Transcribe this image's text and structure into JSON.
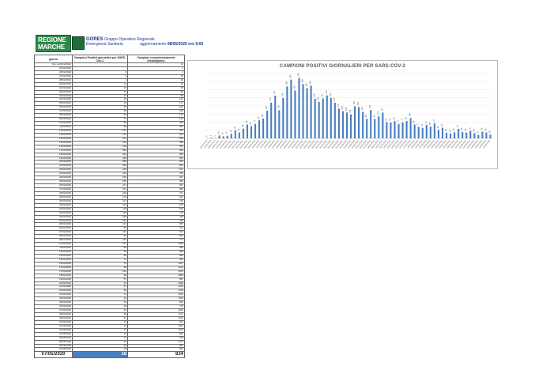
{
  "header": {
    "logo_line1": "REGIONE",
    "logo_line2": "MARCHE",
    "group_name": "GORES",
    "group_line1": "Gruppo Operativo Regionale",
    "group_line2": "Emergenza Sanitaria",
    "update_label": "aggiornamento",
    "update_value": "08/05/2020 ore 9:00"
  },
  "table": {
    "col_date": "giorno",
    "col_positive": "Campioni Positivi giornalieri per SARS-Cov-2",
    "col_total": "Campioni complessivamente testati/giorno",
    "rows": [
      [
        "fino al 24/02/2020",
        "",
        "13"
      ],
      [
        "25/02/2020",
        "",
        "2"
      ],
      [
        "26/02/2020",
        "0",
        "4"
      ],
      [
        "27/02/2020",
        "3",
        "18"
      ],
      [
        "28/02/2020",
        "1",
        "29"
      ],
      [
        "29/02/2020",
        "14",
        "33"
      ],
      [
        "01/03/2020",
        "10",
        "48"
      ],
      [
        "02/03/2020",
        "13",
        "83"
      ],
      [
        "03/03/2020",
        "23",
        "89"
      ],
      [
        "04/03/2020",
        "40",
        "131"
      ],
      [
        "05/03/2020",
        "29",
        "171"
      ],
      [
        "06/03/2020",
        "48",
        "220"
      ],
      [
        "07/03/2020",
        "68",
        "198"
      ],
      [
        "08/03/2020",
        "60",
        "179"
      ],
      [
        "09/03/2020",
        "71",
        "187"
      ],
      [
        "10/03/2020",
        "89",
        "218"
      ],
      [
        "11/03/2020",
        "98",
        "267"
      ],
      [
        "12/03/2020",
        "137",
        "411"
      ],
      [
        "13/03/2020",
        "176",
        "519"
      ],
      [
        "14/03/2020",
        "211",
        "599"
      ],
      [
        "15/03/2020",
        "139",
        "388"
      ],
      [
        "16/03/2020",
        "199",
        "565"
      ],
      [
        "17/03/2020",
        "256",
        "693"
      ],
      [
        "18/03/2020",
        "290",
        "682"
      ],
      [
        "19/03/2020",
        "236",
        "654"
      ],
      [
        "20/03/2020",
        "298",
        "813"
      ],
      [
        "21/03/2020",
        "268",
        "802"
      ],
      [
        "22/03/2020",
        "248",
        "674"
      ],
      [
        "23/03/2020",
        "260",
        "783"
      ],
      [
        "24/03/2020",
        "196",
        "617"
      ],
      [
        "25/03/2020",
        "180",
        "596"
      ],
      [
        "26/03/2020",
        "197",
        "637"
      ],
      [
        "27/03/2020",
        "212",
        "808"
      ],
      [
        "28/03/2020",
        "200",
        "741"
      ],
      [
        "29/03/2020",
        "176",
        "642"
      ],
      [
        "30/03/2020",
        "147",
        "736"
      ],
      [
        "31/03/2020",
        "134",
        "675"
      ],
      [
        "01/04/2020",
        "128",
        "693"
      ],
      [
        "02/04/2020",
        "118",
        "718"
      ],
      [
        "03/04/2020",
        "158",
        "796"
      ],
      [
        "04/04/2020",
        "155",
        "789"
      ],
      [
        "05/04/2020",
        "131",
        "687"
      ],
      [
        "06/04/2020",
        "96",
        "744"
      ],
      [
        "07/04/2020",
        "140",
        "912"
      ],
      [
        "08/04/2020",
        "96",
        "962"
      ],
      [
        "09/04/2020",
        "109",
        "773"
      ],
      [
        "10/04/2020",
        "127",
        "1068"
      ],
      [
        "11/04/2020",
        "80",
        "983"
      ],
      [
        "12/04/2020",
        "78",
        "956"
      ],
      [
        "13/04/2020",
        "85",
        "828"
      ],
      [
        "14/04/2020",
        "71",
        "981"
      ],
      [
        "15/04/2020",
        "79",
        "1187"
      ],
      [
        "16/04/2020",
        "86",
        "1012"
      ],
      [
        "17/04/2020",
        "100",
        "1251"
      ],
      [
        "18/04/2020",
        "68",
        "1089"
      ],
      [
        "19/04/2020",
        "57",
        "987"
      ],
      [
        "20/04/2020",
        "52",
        "1090"
      ],
      [
        "21/04/2020",
        "67",
        "1231"
      ],
      [
        "22/04/2020",
        "58",
        "1249"
      ],
      [
        "23/04/2020",
        "74",
        "1304"
      ],
      [
        "24/04/2020",
        "42",
        "1046"
      ],
      [
        "25/04/2020",
        "53",
        "891"
      ],
      [
        "26/04/2020",
        "28",
        "779"
      ],
      [
        "27/04/2020",
        "24",
        "1064"
      ],
      [
        "28/04/2020",
        "30",
        "1117"
      ],
      [
        "29/04/2020",
        "47",
        "1106"
      ],
      [
        "30/04/2020",
        "32",
        "922"
      ],
      [
        "01/05/2020",
        "29",
        "1031"
      ],
      [
        "02/05/2020",
        "37",
        "1133"
      ],
      [
        "03/05/2020",
        "26",
        "891"
      ],
      [
        "04/05/2020",
        "17",
        "756"
      ],
      [
        "05/05/2020",
        "33",
        "1077"
      ],
      [
        "06/05/2020",
        "29",
        "981"
      ],
      [
        "07/05/2020",
        "18",
        "834"
      ]
    ],
    "footer": {
      "date": "07/05/2020",
      "positive": "18",
      "total": "834"
    }
  },
  "chart_data": {
    "type": "bar",
    "title": "CAMPIONI POSITIVI GIORNALIERI PER SARS-COV-2",
    "xlabel": "",
    "ylabel": "",
    "ylim": [
      0,
      320
    ],
    "grid": true,
    "legend": "none",
    "bar_color": "#4a7fc1",
    "categories": [
      "26/02/2020",
      "27/02/2020",
      "28/02/2020",
      "29/02/2020",
      "01/03/2020",
      "02/03/2020",
      "03/03/2020",
      "04/03/2020",
      "05/03/2020",
      "06/03/2020",
      "07/03/2020",
      "08/03/2020",
      "09/03/2020",
      "10/03/2020",
      "11/03/2020",
      "12/03/2020",
      "13/03/2020",
      "14/03/2020",
      "15/03/2020",
      "16/03/2020",
      "17/03/2020",
      "18/03/2020",
      "19/03/2020",
      "20/03/2020",
      "21/03/2020",
      "22/03/2020",
      "23/03/2020",
      "24/03/2020",
      "25/03/2020",
      "26/03/2020",
      "27/03/2020",
      "28/03/2020",
      "29/03/2020",
      "30/03/2020",
      "31/03/2020",
      "01/04/2020",
      "02/04/2020",
      "03/04/2020",
      "04/04/2020",
      "05/04/2020",
      "06/04/2020",
      "07/04/2020",
      "08/04/2020",
      "09/04/2020",
      "10/04/2020",
      "11/04/2020",
      "12/04/2020",
      "13/04/2020",
      "14/04/2020",
      "15/04/2020",
      "16/04/2020",
      "17/04/2020",
      "18/04/2020",
      "19/04/2020",
      "20/04/2020",
      "21/04/2020",
      "22/04/2020",
      "23/04/2020",
      "24/04/2020",
      "25/04/2020",
      "26/04/2020",
      "27/04/2020",
      "28/04/2020",
      "29/04/2020",
      "30/04/2020",
      "01/05/2020",
      "02/05/2020",
      "03/05/2020",
      "04/05/2020",
      "05/05/2020",
      "06/05/2020",
      "07/05/2020"
    ],
    "values": [
      0,
      3,
      1,
      14,
      10,
      13,
      23,
      40,
      29,
      48,
      68,
      60,
      71,
      89,
      98,
      137,
      176,
      211,
      139,
      199,
      256,
      290,
      236,
      298,
      268,
      248,
      260,
      196,
      180,
      197,
      212,
      200,
      176,
      147,
      134,
      128,
      118,
      158,
      155,
      131,
      96,
      140,
      96,
      109,
      127,
      80,
      78,
      85,
      71,
      79,
      86,
      100,
      68,
      57,
      52,
      67,
      58,
      74,
      42,
      53,
      28,
      24,
      30,
      47,
      32,
      29,
      37,
      26,
      17,
      33,
      29,
      18
    ]
  }
}
